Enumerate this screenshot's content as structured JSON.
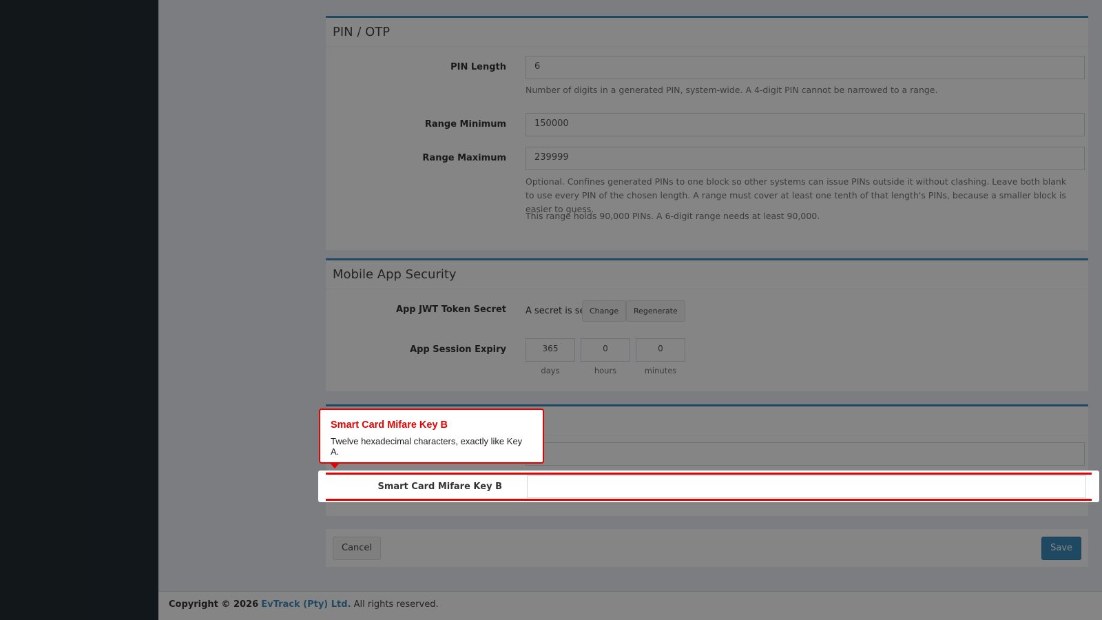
{
  "sections": {
    "pin": {
      "title": "PIN / OTP",
      "pin_length_label": "PIN Length",
      "pin_length_value": "6",
      "pin_length_help": "Number of digits in a generated PIN, system-wide. A 4-digit PIN cannot be narrowed to a range.",
      "range_min_label": "Range Minimum",
      "range_min_value": "150000",
      "range_max_label": "Range Maximum",
      "range_max_value": "239999",
      "range_help_1": "Optional. Confines generated PINs to one block so other systems can issue PINs outside it without clashing. Leave both blank to use every PIN of the chosen length. A range must cover at least one tenth of that length's PINs, because a smaller block is easier to guess.",
      "range_help_2": "This range holds 90,000 PINs. A 6-digit range needs at least 90,000."
    },
    "mobile": {
      "title": "Mobile App Security",
      "jwt_label": "App JWT Token Secret",
      "jwt_status": "A secret is set",
      "change_button": "Change",
      "regenerate_button": "Regenerate",
      "expiry_label": "App Session Expiry",
      "days_value": "365",
      "hours_value": "0",
      "minutes_value": "0",
      "days_unit": "days",
      "hours_unit": "hours",
      "minutes_unit": "minutes"
    },
    "smartcard": {
      "key_a_value": "",
      "key_b_label": "Smart Card Mifare Key B",
      "key_b_value": ""
    }
  },
  "actions": {
    "cancel": "Cancel",
    "save": "Save"
  },
  "footer": {
    "copyright": "Copyright © 2026",
    "company": "EvTrack (Pty) Ltd.",
    "rights": "All rights reserved."
  },
  "tooltip": {
    "title": "Smart Card Mifare Key B",
    "body": "Twelve hexadecimal characters, exactly like Key A."
  },
  "colors": {
    "accent": "#3c8dbc",
    "highlight": "#e60000",
    "sidebar": "#222d32"
  }
}
